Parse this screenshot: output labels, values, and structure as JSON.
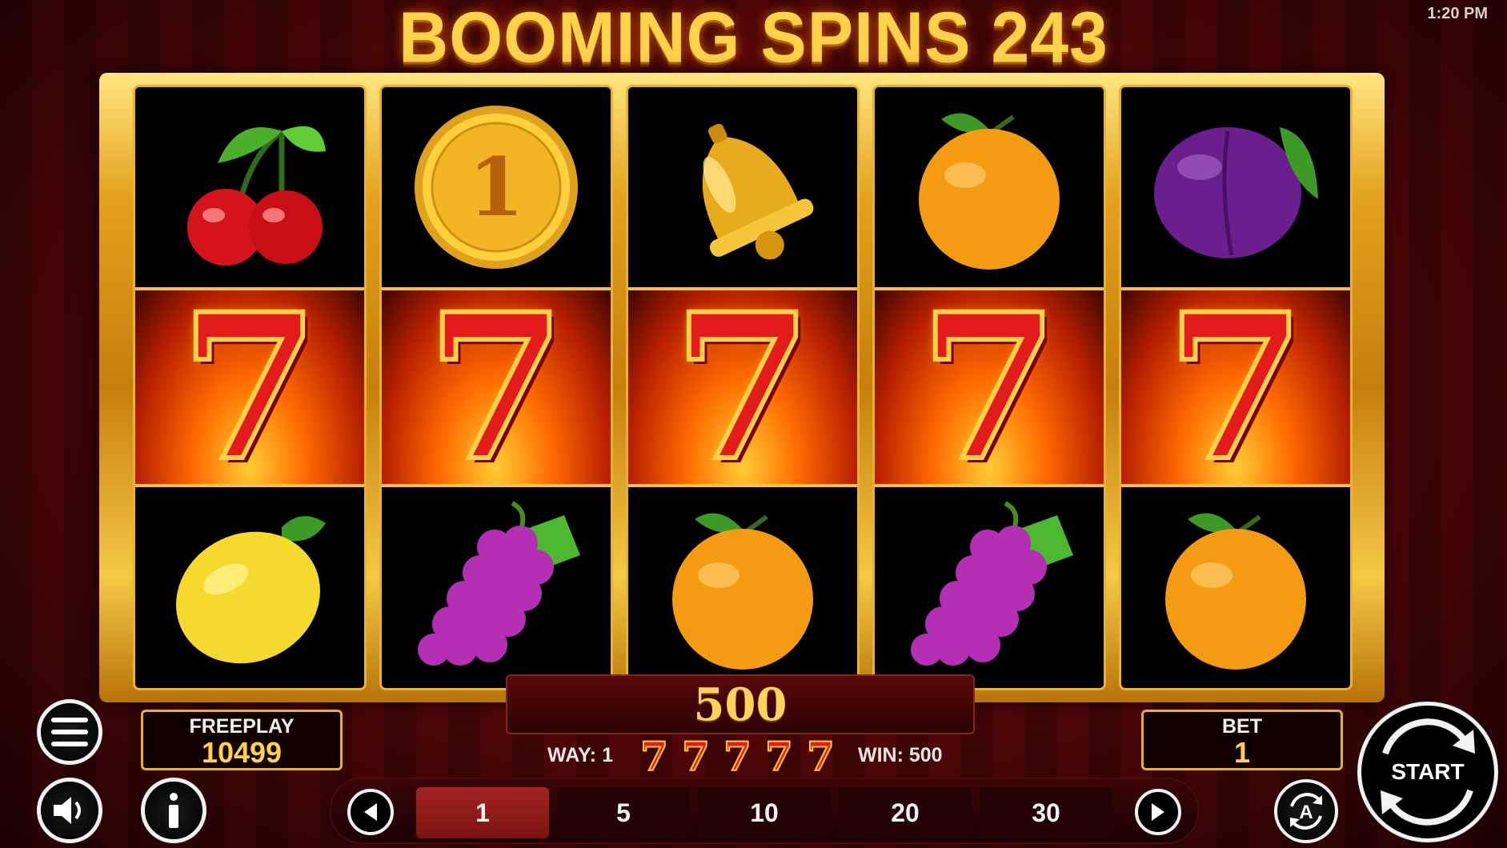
{
  "status_bar": {
    "time": "1:20 PM"
  },
  "game": {
    "title": "BOOMING SPINS 243"
  },
  "reels": [
    {
      "symbols": [
        "cherries",
        "seven",
        "lemon"
      ]
    },
    {
      "symbols": [
        "coin-1",
        "seven",
        "grapes"
      ]
    },
    {
      "symbols": [
        "bell",
        "seven",
        "orange"
      ]
    },
    {
      "symbols": [
        "orange",
        "seven",
        "grapes"
      ]
    },
    {
      "symbols": [
        "plum",
        "seven",
        "orange"
      ]
    }
  ],
  "symbol_text": {
    "seven": "7",
    "coin": "1"
  },
  "win_display": {
    "amount": "500"
  },
  "win_line": {
    "way": "WAY: 1",
    "win": "WIN: 500",
    "symbol": "7"
  },
  "balance": {
    "label": "FREEPLAY",
    "value": "10499"
  },
  "bet": {
    "label": "BET",
    "value": "1"
  },
  "bet_options": {
    "items": [
      "1",
      "5",
      "10",
      "20",
      "30"
    ],
    "selected": "1"
  },
  "controls": {
    "start_label": "START",
    "autoplay_label": "A"
  },
  "icons": {
    "menu": "menu-icon",
    "sound": "speaker-icon",
    "info": "info-icon",
    "prev": "arrow-left-icon",
    "next": "arrow-right-icon",
    "autoplay": "autoplay-icon",
    "start": "spin-arrows-icon"
  },
  "colors": {
    "gold": "#ffd24a",
    "frame": "#e3a11d",
    "background": "#5a0708",
    "active_bet": "#a32320"
  }
}
